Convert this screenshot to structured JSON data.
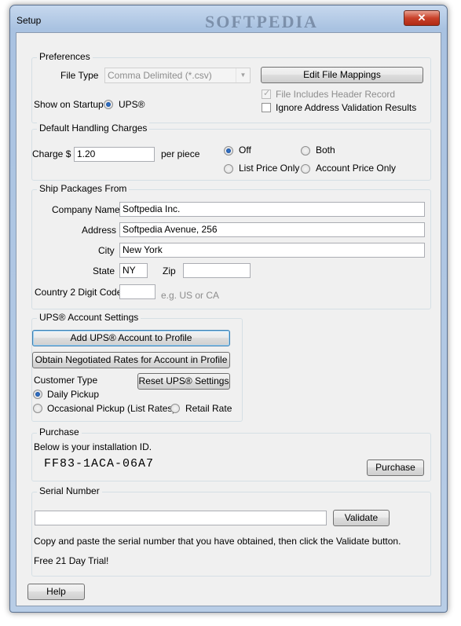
{
  "window": {
    "title": "Setup",
    "watermark": "SOFTPEDIA",
    "close_glyph": "✕"
  },
  "preferences": {
    "group_title": "Preferences",
    "file_type_label": "File Type",
    "file_type_value": "Comma Delimited (*.csv)",
    "edit_mappings_button": "Edit File Mappings",
    "header_record_label": "File Includes Header Record",
    "header_record_checked": true,
    "ignore_validation_label": "Ignore Address Validation Results",
    "ignore_validation_checked": false,
    "show_on_startup_label": "Show on Startup",
    "ups_radio_label": "UPS®"
  },
  "handling": {
    "group_title": "Default Handling Charges",
    "charge_label": "Charge  $",
    "charge_value": "1.20",
    "per_piece_label": "per piece",
    "options": {
      "off": "Off",
      "both": "Both",
      "list_price_only": "List Price Only",
      "account_price_only": "Account Price Only"
    },
    "selected": "Off"
  },
  "ship_from": {
    "group_title": "Ship Packages From",
    "company_name_label": "Company Name",
    "company_name_value": "Softpedia Inc.",
    "address_label": "Address",
    "address_value": "Softpedia Avenue, 256",
    "city_label": "City",
    "city_value": "New York",
    "state_label": "State",
    "state_value": "NY",
    "zip_label": "Zip",
    "zip_value": "",
    "country_label": "Country 2 Digit Code",
    "country_value": "",
    "country_hint": "e.g.  US or CA"
  },
  "ups_account": {
    "group_title": "UPS® Account Settings",
    "add_account_button": "Add UPS® Account to Profile",
    "negotiated_rates_button": "Obtain Negotiated Rates for Account in Profile",
    "customer_type_label": "Customer Type",
    "reset_button": "Reset UPS® Settings",
    "options": {
      "daily_pickup": "Daily Pickup",
      "occasional_pickup": "Occasional Pickup (List Rates)",
      "retail_rate": "Retail Rate"
    },
    "selected": "Daily Pickup"
  },
  "purchase": {
    "group_title": "Purchase",
    "install_id_label": "Below is your installation ID.",
    "install_id": "FF83-1ACA-06A7",
    "purchase_button": "Purchase"
  },
  "serial": {
    "group_title": "Serial Number",
    "serial_value": "",
    "validate_button": "Validate",
    "instructions": "Copy and paste the serial number that you have obtained, then click the Validate button.",
    "trial_text": "Free 21 Day Trial!"
  },
  "footer": {
    "help_button": "Help"
  }
}
